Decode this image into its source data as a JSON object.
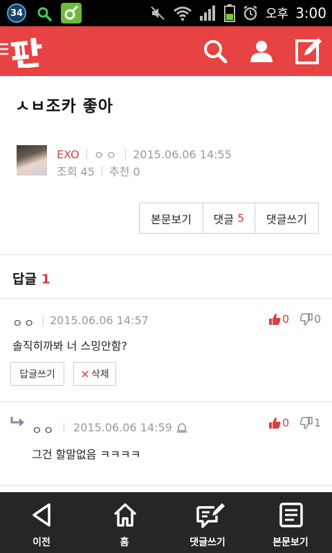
{
  "status_bar": {
    "badge": "34",
    "ampm": "오후",
    "time": "3:00"
  },
  "post": {
    "title": "ㅅㅂ조카 좋아",
    "author": "EXO",
    "nickname": "ㅇㅇ",
    "datetime": "2015.06.06 14:55",
    "views": "조회 45",
    "recommends": "추천 0",
    "buttons": {
      "view_body": "본문보기",
      "comments_label": "댓글",
      "comments_count": "5",
      "write_comment": "댓글쓰기"
    }
  },
  "replies_section": {
    "label": "답글",
    "count": "1"
  },
  "comments": [
    {
      "author": "ㅇㅇ",
      "datetime": "2015.06.06 14:57",
      "text": "솔직히까봐 너 스밍안함?",
      "likes": "0",
      "dislikes": "0",
      "reply_button": "답글쓰기",
      "delete_button": "삭제"
    },
    {
      "author": "ㅇㅇ",
      "datetime": "2015.06.06 14:59",
      "text": "그건 할말없음 ㅋㅋㅋㅋ",
      "likes": "0",
      "dislikes": "1"
    }
  ],
  "bottom_nav": [
    {
      "label": "이전",
      "icon": "back-icon"
    },
    {
      "label": "홈",
      "icon": "home-icon"
    },
    {
      "label": "댓글쓰기",
      "icon": "comment-write-icon"
    },
    {
      "label": "본문보기",
      "icon": "document-icon"
    }
  ],
  "colors": {
    "brand": "#e84343",
    "accent_text": "#d94040",
    "nav_background": "#262626"
  }
}
